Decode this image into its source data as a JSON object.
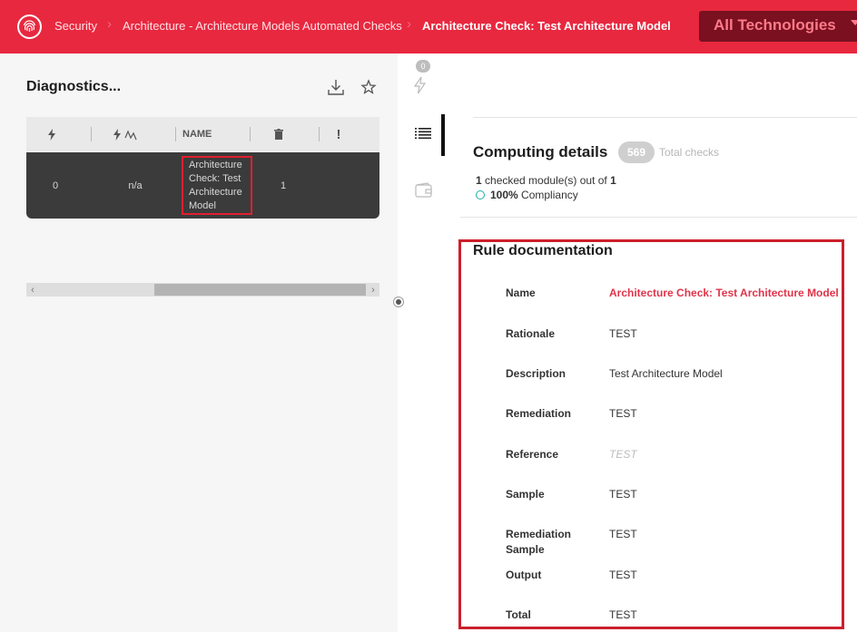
{
  "header": {
    "breadcrumbs": [
      "Security",
      "Architecture - Architecture Models Automated Checks",
      "Architecture Check: Test Architecture Model"
    ],
    "technology_selector": "All Technologies",
    "colors": {
      "bar": "#e8283f",
      "selector": "#7a1020"
    }
  },
  "diagnostics": {
    "title": "Diagnostics...",
    "actions": [
      "download-icon",
      "star-icon"
    ],
    "columns": [
      {
        "icon": "lightning-icon",
        "label": ""
      },
      {
        "icon": "lightning-trend-icon",
        "label": ""
      },
      {
        "icon": "",
        "label": "NAME"
      },
      {
        "icon": "trash-icon",
        "label": ""
      },
      {
        "icon": "exclamation-icon",
        "label": "!"
      }
    ],
    "rows": [
      {
        "violations": "0",
        "trend": "n/a",
        "name": "Architecture Check: Test Architecture Model",
        "count": "1"
      }
    ]
  },
  "rail": {
    "badge": "0"
  },
  "computing": {
    "title": "Computing details",
    "total_checks": "569",
    "total_label": "Total checks",
    "checked_count": "1",
    "checked_text": "checked module(s) out of",
    "checked_total": "1",
    "compliance": "100%",
    "compliance_label": "Compliancy"
  },
  "rule_doc": {
    "title": "Rule documentation",
    "fields": [
      {
        "label": "Name",
        "value": "Architecture Check: Test Architecture Model"
      },
      {
        "label": "Rationale",
        "value": "TEST"
      },
      {
        "label": "Description",
        "value": "Test Architecture Model"
      },
      {
        "label": "Remediation",
        "value": "TEST"
      },
      {
        "label": "Reference",
        "value": "TEST"
      },
      {
        "label": "Sample",
        "value": "TEST"
      },
      {
        "label": "Remediation Sample",
        "value": "TEST"
      },
      {
        "label": "Output",
        "value": "TEST"
      },
      {
        "label": "Total",
        "value": "TEST"
      }
    ]
  }
}
